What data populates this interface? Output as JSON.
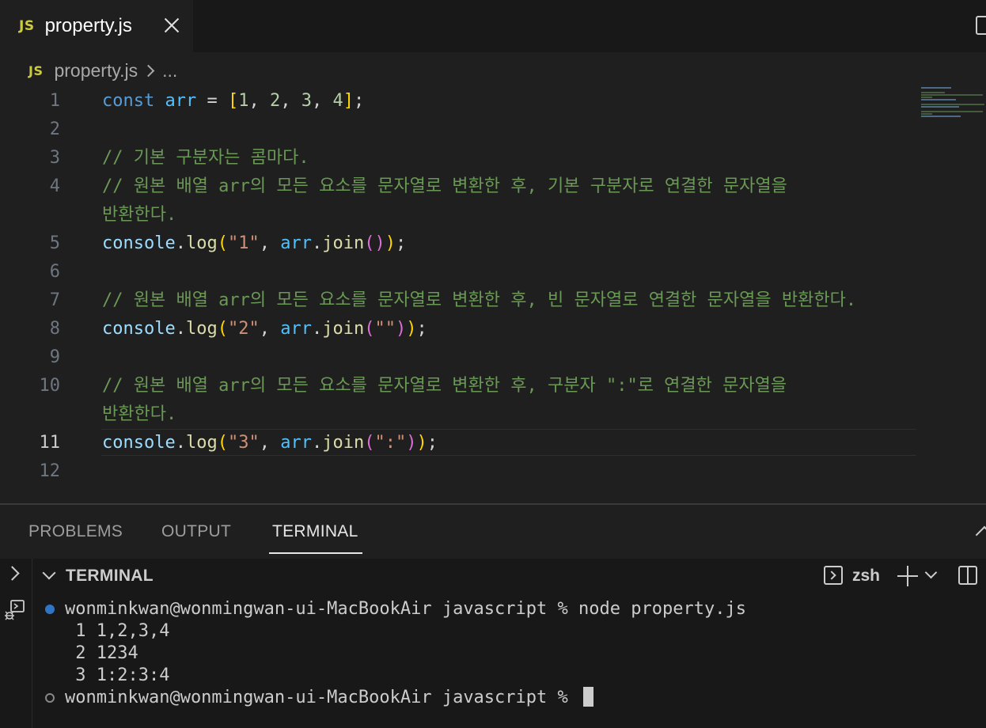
{
  "tab": {
    "badge": "JS",
    "filename": "property.js"
  },
  "breadcrumb": {
    "badge": "JS",
    "file": "property.js",
    "rest": "..."
  },
  "editor": {
    "line_numbers": [
      "1",
      "2",
      "3",
      "4",
      "5",
      "6",
      "7",
      "8",
      "9",
      "10",
      "11",
      "12"
    ],
    "active_line": "11",
    "line1": {
      "kw": "const",
      "name": "arr",
      "eq": " = ",
      "ob": "[",
      "n1": "1",
      "n2": "2",
      "n3": "3",
      "n4": "4",
      "cb": "]",
      "comma": ", ",
      "semi": ";"
    },
    "comment3": "// 기본 구분자는 콤마다.",
    "comment4a": "// 원본 배열 arr의 모든 요소를 문자열로 변환한 후, 기본 구분자로 연결한 문자열을",
    "comment4b": "반환한다.",
    "comment7": "// 원본 배열 arr의 모든 요소를 문자열로 변환한 후, 빈 문자열로 연결한 문자열을 반환한다.",
    "comment10a": "// 원본 배열 arr의 모든 요소를 문자열로 변환한 후, 구분자 \":\"로 연결한 문자열을",
    "comment10b": "반환한다.",
    "log": {
      "obj": "console",
      "dot": ".",
      "fn": "log",
      "arr": "arr",
      "join": "join",
      "comma": ", ",
      "semi": ";"
    },
    "log5_label": "\"1\"",
    "log8_label": "\"2\"",
    "log8_arg": "\"\"",
    "log11_label": "\"3\"",
    "log11_arg": "\":\""
  },
  "panel": {
    "tabs": [
      "PROBLEMS",
      "OUTPUT",
      "TERMINAL"
    ],
    "active_tab": "TERMINAL",
    "terminal_title": "TERMINAL",
    "shell": "zsh"
  },
  "terminal": {
    "command_line": "wonminkwan@wonmingwan-ui-MacBookAir javascript % node property.js",
    "output": [
      "1 1,2,3,4",
      "2 1234",
      "3 1:2:3:4"
    ],
    "prompt": "wonminkwan@wonmingwan-ui-MacBookAir javascript % "
  },
  "colors": {
    "keyword": "#569cd6",
    "variable": "#4fc1ff",
    "string": "#ce9178",
    "comment": "#6a9955",
    "function": "#dcdcaa",
    "number": "#b5cea8",
    "bracket1": "#ffd700",
    "bracket2": "#da70d6",
    "js_badge": "#cbcb41"
  },
  "icons": [
    "close-icon",
    "split-editor-icon",
    "chevron-right-icon",
    "terminal-icon",
    "plus-icon",
    "chevron-down-icon",
    "split-terminal-icon",
    "debug-icon",
    "maximize-panel-icon"
  ]
}
